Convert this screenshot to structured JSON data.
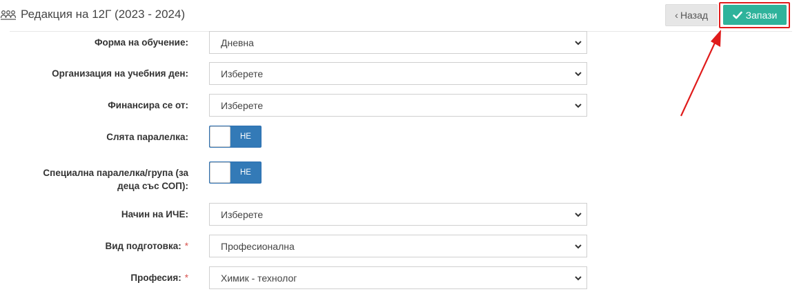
{
  "header": {
    "title": "Редакция на 12Г (2023 - 2024)",
    "title_icon": "group-icon",
    "back_label": "Назад",
    "save_label": "Запази"
  },
  "form": {
    "education_form": {
      "label": "Форма на обучение:",
      "value": "Дневна"
    },
    "day_organization": {
      "label": "Организация на учебния ден:",
      "value": "Изберете"
    },
    "funded_by": {
      "label": "Финансира се от:",
      "value": "Изберете"
    },
    "merged_class": {
      "label": "Слята паралелка:",
      "toggle": "НЕ"
    },
    "special_class": {
      "label_line1": "Специална паралелка/група (за",
      "label_line2": "деца със СОП):",
      "toggle": "НЕ"
    },
    "iche_method": {
      "label": "Начин на ИЧЕ:",
      "value": "Изберете"
    },
    "training_type": {
      "label": "Вид подготовка:",
      "required": "*",
      "value": "Професионална"
    },
    "profession": {
      "label": "Професия:",
      "required": "*",
      "value": "Химик - технолог"
    }
  },
  "colors": {
    "save_button": "#2fb39b",
    "toggle": "#337ab7",
    "highlight": "#e01b1b"
  }
}
